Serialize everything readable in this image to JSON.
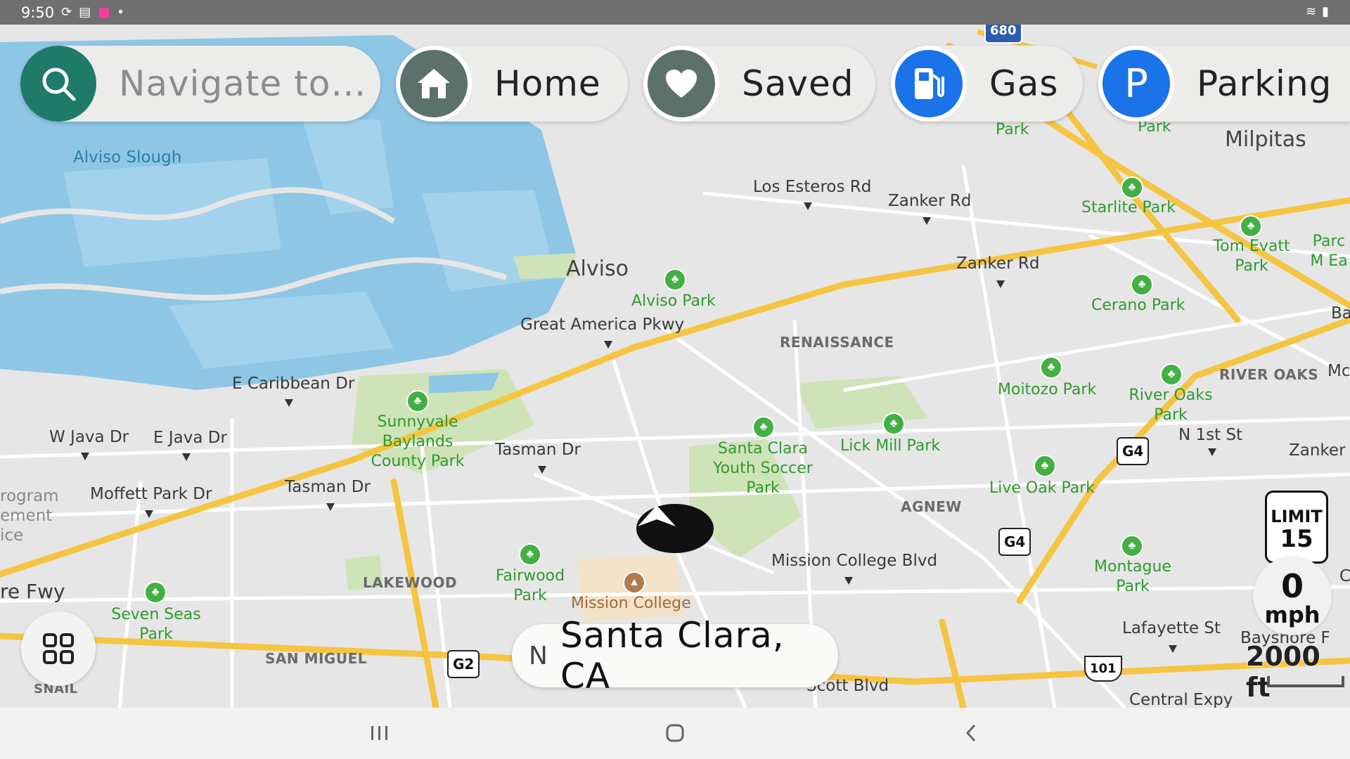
{
  "status_bar": {
    "time": "9:50",
    "left_icons": [
      "sync-icon",
      "news-icon",
      "shop-icon",
      "dot-icon"
    ],
    "right_icons": [
      "wifi-icon",
      "battery-icon"
    ]
  },
  "top_bar": {
    "search_placeholder": "Navigate to…",
    "home_label": "Home",
    "saved_label": "Saved",
    "gas_label": "Gas",
    "parking_label": "Parking",
    "parking_letter": "P"
  },
  "map": {
    "cities": {
      "milpitas": "Milpitas",
      "alviso": "Alviso"
    },
    "water": {
      "alviso_slough": "Alviso Slough"
    },
    "streets": {
      "los_esteros": "Los Esteros Rd",
      "zanker_1": "Zanker Rd",
      "zanker_2": "Zanker Rd",
      "zanker_3": "Zanker R",
      "great_america": "Great America Pkwy",
      "e_caribbean": "E Caribbean Dr",
      "w_java": "W Java Dr",
      "e_java": "E Java Dr",
      "tasman_1": "Tasman Dr",
      "tasman_2": "Tasman Dr",
      "moffett_park": "Moffett Park Dr",
      "mission_college_blvd": "Mission College Blvd",
      "n_1st": "N 1st St",
      "lafayette": "Lafayette St",
      "bayshore": "Bayshore F",
      "scott": "Scott Blvd",
      "central_expy": "Central Expy",
      "fwy": "re Fwy",
      "program": "rogram",
      "ement": "ement",
      "ice": "ice",
      "snail": "SNAIL",
      "mo": "Mc",
      "ba": "Ba",
      "c": "C"
    },
    "neighborhoods": {
      "renaissance": "RENAISSANCE",
      "river_oaks": "RIVER OAKS",
      "agnew": "AGNEW",
      "lakewood": "LAKEWOOD",
      "san_miguel": "SAN MIGUEL"
    },
    "parks": {
      "park_a": "Park",
      "park_b": "Park",
      "starlite": "Starlite Park",
      "tom_evatt": "Tom Evatt Park",
      "parc": "Parc M Ea",
      "alviso_park": "Alviso Park",
      "cerano": "Cerano Park",
      "moitozo": "Moitozo Park",
      "river_oaks_park": "River Oaks Park",
      "sunnyvale_baylands": "Sunnyvale Baylands County Park",
      "santa_clara_youth": "Santa Clara Youth Soccer Park",
      "lick_mill": "Lick Mill Park",
      "live_oak": "Live Oak Park",
      "montague": "Montague Park",
      "fairwood": "Fairwood Park",
      "seven_seas": "Seven Seas Park"
    },
    "poi": {
      "mission_college": "Mission College"
    },
    "shields": {
      "g4_a": "G4",
      "g4_b": "G4",
      "g2": "G2",
      "us101": "101",
      "i680": "680"
    }
  },
  "speed": {
    "limit_title": "LIMIT",
    "limit_value": "15",
    "current_value": "0",
    "current_unit": "mph"
  },
  "scale": {
    "label": "2000 ft"
  },
  "location": {
    "heading": "N",
    "place": "Santa Clara, CA"
  },
  "colors": {
    "water": "#8ec6e6",
    "land": "#e6e6e6",
    "park": "#cfe3b8",
    "highway": "#f5c542",
    "search_accent": "#1f7a6a",
    "gas_blue": "#1a73e8",
    "parking_blue": "#1a73e8",
    "home_grey": "#5d716c"
  }
}
